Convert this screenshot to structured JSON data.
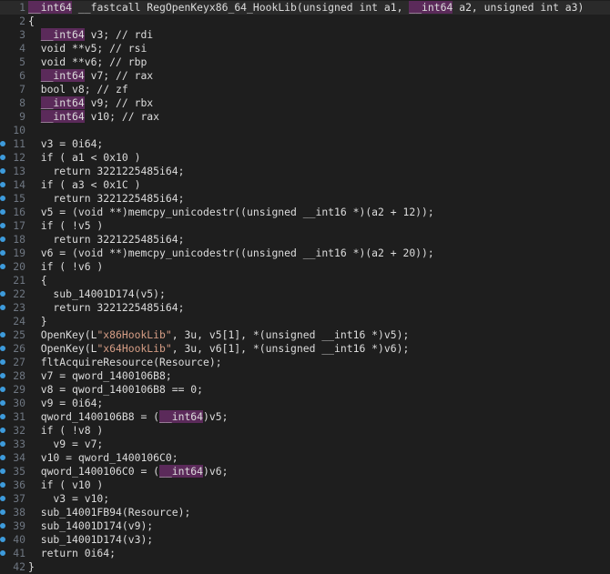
{
  "editor": {
    "current_line": 1,
    "lines": [
      {
        "n": "1",
        "bp": false,
        "segs": [
          {
            "c": "t-hl",
            "t": "__int64"
          },
          {
            "c": "t-id",
            "t": " __fastcall RegOpenKeyx86_64_HookLib(unsigned int a1, "
          },
          {
            "c": "t-hl",
            "t": "__int64"
          },
          {
            "c": "t-id",
            "t": " a2, unsigned int a3)"
          }
        ]
      },
      {
        "n": "2",
        "bp": false,
        "segs": [
          {
            "c": "t-id",
            "t": "{"
          }
        ]
      },
      {
        "n": "3",
        "bp": false,
        "segs": [
          {
            "c": "t-id",
            "t": "  "
          },
          {
            "c": "t-hl",
            "t": "__int64"
          },
          {
            "c": "t-id",
            "t": " v3; // rdi"
          }
        ]
      },
      {
        "n": "4",
        "bp": false,
        "segs": [
          {
            "c": "t-id",
            "t": "  void **v5; // rsi"
          }
        ]
      },
      {
        "n": "5",
        "bp": false,
        "segs": [
          {
            "c": "t-id",
            "t": "  void **v6; // rbp"
          }
        ]
      },
      {
        "n": "6",
        "bp": false,
        "segs": [
          {
            "c": "t-id",
            "t": "  "
          },
          {
            "c": "t-hl",
            "t": "__int64"
          },
          {
            "c": "t-id",
            "t": " v7; // rax"
          }
        ]
      },
      {
        "n": "7",
        "bp": false,
        "segs": [
          {
            "c": "t-id",
            "t": "  bool v8; // zf"
          }
        ]
      },
      {
        "n": "8",
        "bp": false,
        "segs": [
          {
            "c": "t-id",
            "t": "  "
          },
          {
            "c": "t-hl",
            "t": "__int64"
          },
          {
            "c": "t-id",
            "t": " v9; // rbx"
          }
        ]
      },
      {
        "n": "9",
        "bp": false,
        "segs": [
          {
            "c": "t-id",
            "t": "  "
          },
          {
            "c": "t-hl",
            "t": "__int64"
          },
          {
            "c": "t-id",
            "t": " v10; // rax"
          }
        ]
      },
      {
        "n": "10",
        "bp": false,
        "segs": [
          {
            "c": "t-id",
            "t": ""
          }
        ]
      },
      {
        "n": "11",
        "bp": true,
        "segs": [
          {
            "c": "t-id",
            "t": "  v3 = 0i64;"
          }
        ]
      },
      {
        "n": "12",
        "bp": true,
        "segs": [
          {
            "c": "t-id",
            "t": "  if ( a1 < 0x10 )"
          }
        ]
      },
      {
        "n": "13",
        "bp": true,
        "segs": [
          {
            "c": "t-id",
            "t": "    return 3221225485i64;"
          }
        ]
      },
      {
        "n": "14",
        "bp": true,
        "segs": [
          {
            "c": "t-id",
            "t": "  if ( a3 < 0x1C )"
          }
        ]
      },
      {
        "n": "15",
        "bp": true,
        "segs": [
          {
            "c": "t-id",
            "t": "    return 3221225485i64;"
          }
        ]
      },
      {
        "n": "16",
        "bp": true,
        "segs": [
          {
            "c": "t-id",
            "t": "  v5 = (void **)memcpy_unicodestr((unsigned __int16 *)(a2 + 12));"
          }
        ]
      },
      {
        "n": "17",
        "bp": true,
        "segs": [
          {
            "c": "t-id",
            "t": "  if ( !v5 )"
          }
        ]
      },
      {
        "n": "18",
        "bp": true,
        "segs": [
          {
            "c": "t-id",
            "t": "    return 3221225485i64;"
          }
        ]
      },
      {
        "n": "19",
        "bp": true,
        "segs": [
          {
            "c": "t-id",
            "t": "  v6 = (void **)memcpy_unicodestr((unsigned __int16 *)(a2 + 20));"
          }
        ]
      },
      {
        "n": "20",
        "bp": true,
        "segs": [
          {
            "c": "t-id",
            "t": "  if ( !v6 )"
          }
        ]
      },
      {
        "n": "21",
        "bp": false,
        "segs": [
          {
            "c": "t-id",
            "t": "  {"
          }
        ]
      },
      {
        "n": "22",
        "bp": true,
        "segs": [
          {
            "c": "t-id",
            "t": "    sub_14001D174(v5);"
          }
        ]
      },
      {
        "n": "23",
        "bp": true,
        "segs": [
          {
            "c": "t-id",
            "t": "    return 3221225485i64;"
          }
        ]
      },
      {
        "n": "24",
        "bp": false,
        "segs": [
          {
            "c": "t-id",
            "t": "  }"
          }
        ]
      },
      {
        "n": "25",
        "bp": true,
        "segs": [
          {
            "c": "t-id",
            "t": "  OpenKey(L"
          },
          {
            "c": "t-str",
            "t": "\"x86HookLib\""
          },
          {
            "c": "t-id",
            "t": ", 3u, v5[1], *(unsigned __int16 *)v5);"
          }
        ]
      },
      {
        "n": "26",
        "bp": true,
        "segs": [
          {
            "c": "t-id",
            "t": "  OpenKey(L"
          },
          {
            "c": "t-str",
            "t": "\"x64HookLib\""
          },
          {
            "c": "t-id",
            "t": ", 3u, v6[1], *(unsigned __int16 *)v6);"
          }
        ]
      },
      {
        "n": "27",
        "bp": true,
        "segs": [
          {
            "c": "t-id",
            "t": "  fltAcquireResource(Resource);"
          }
        ]
      },
      {
        "n": "28",
        "bp": true,
        "segs": [
          {
            "c": "t-id",
            "t": "  v7 = qword_1400106B8;"
          }
        ]
      },
      {
        "n": "29",
        "bp": true,
        "segs": [
          {
            "c": "t-id",
            "t": "  v8 = qword_1400106B8 == 0;"
          }
        ]
      },
      {
        "n": "30",
        "bp": true,
        "segs": [
          {
            "c": "t-id",
            "t": "  v9 = 0i64;"
          }
        ]
      },
      {
        "n": "31",
        "bp": true,
        "segs": [
          {
            "c": "t-id",
            "t": "  qword_1400106B8 = ("
          },
          {
            "c": "t-hl",
            "t": "__int64"
          },
          {
            "c": "t-id",
            "t": ")v5;"
          }
        ]
      },
      {
        "n": "32",
        "bp": true,
        "segs": [
          {
            "c": "t-id",
            "t": "  if ( !v8 )"
          }
        ]
      },
      {
        "n": "33",
        "bp": true,
        "segs": [
          {
            "c": "t-id",
            "t": "    v9 = v7;"
          }
        ]
      },
      {
        "n": "34",
        "bp": true,
        "segs": [
          {
            "c": "t-id",
            "t": "  v10 = qword_1400106C0;"
          }
        ]
      },
      {
        "n": "35",
        "bp": true,
        "segs": [
          {
            "c": "t-id",
            "t": "  qword_1400106C0 = ("
          },
          {
            "c": "t-hl",
            "t": "__int64"
          },
          {
            "c": "t-id",
            "t": ")v6;"
          }
        ]
      },
      {
        "n": "36",
        "bp": true,
        "segs": [
          {
            "c": "t-id",
            "t": "  if ( v10 )"
          }
        ]
      },
      {
        "n": "37",
        "bp": true,
        "segs": [
          {
            "c": "t-id",
            "t": "    v3 = v10;"
          }
        ]
      },
      {
        "n": "38",
        "bp": true,
        "segs": [
          {
            "c": "t-id",
            "t": "  sub_14001FB94(Resource);"
          }
        ]
      },
      {
        "n": "39",
        "bp": true,
        "segs": [
          {
            "c": "t-id",
            "t": "  sub_14001D174(v9);"
          }
        ]
      },
      {
        "n": "40",
        "bp": true,
        "segs": [
          {
            "c": "t-id",
            "t": "  sub_14001D174(v3);"
          }
        ]
      },
      {
        "n": "41",
        "bp": true,
        "segs": [
          {
            "c": "t-id",
            "t": "  return 0i64;"
          }
        ]
      },
      {
        "n": "42",
        "bp": false,
        "segs": [
          {
            "c": "t-id",
            "t": "}"
          }
        ]
      }
    ]
  }
}
